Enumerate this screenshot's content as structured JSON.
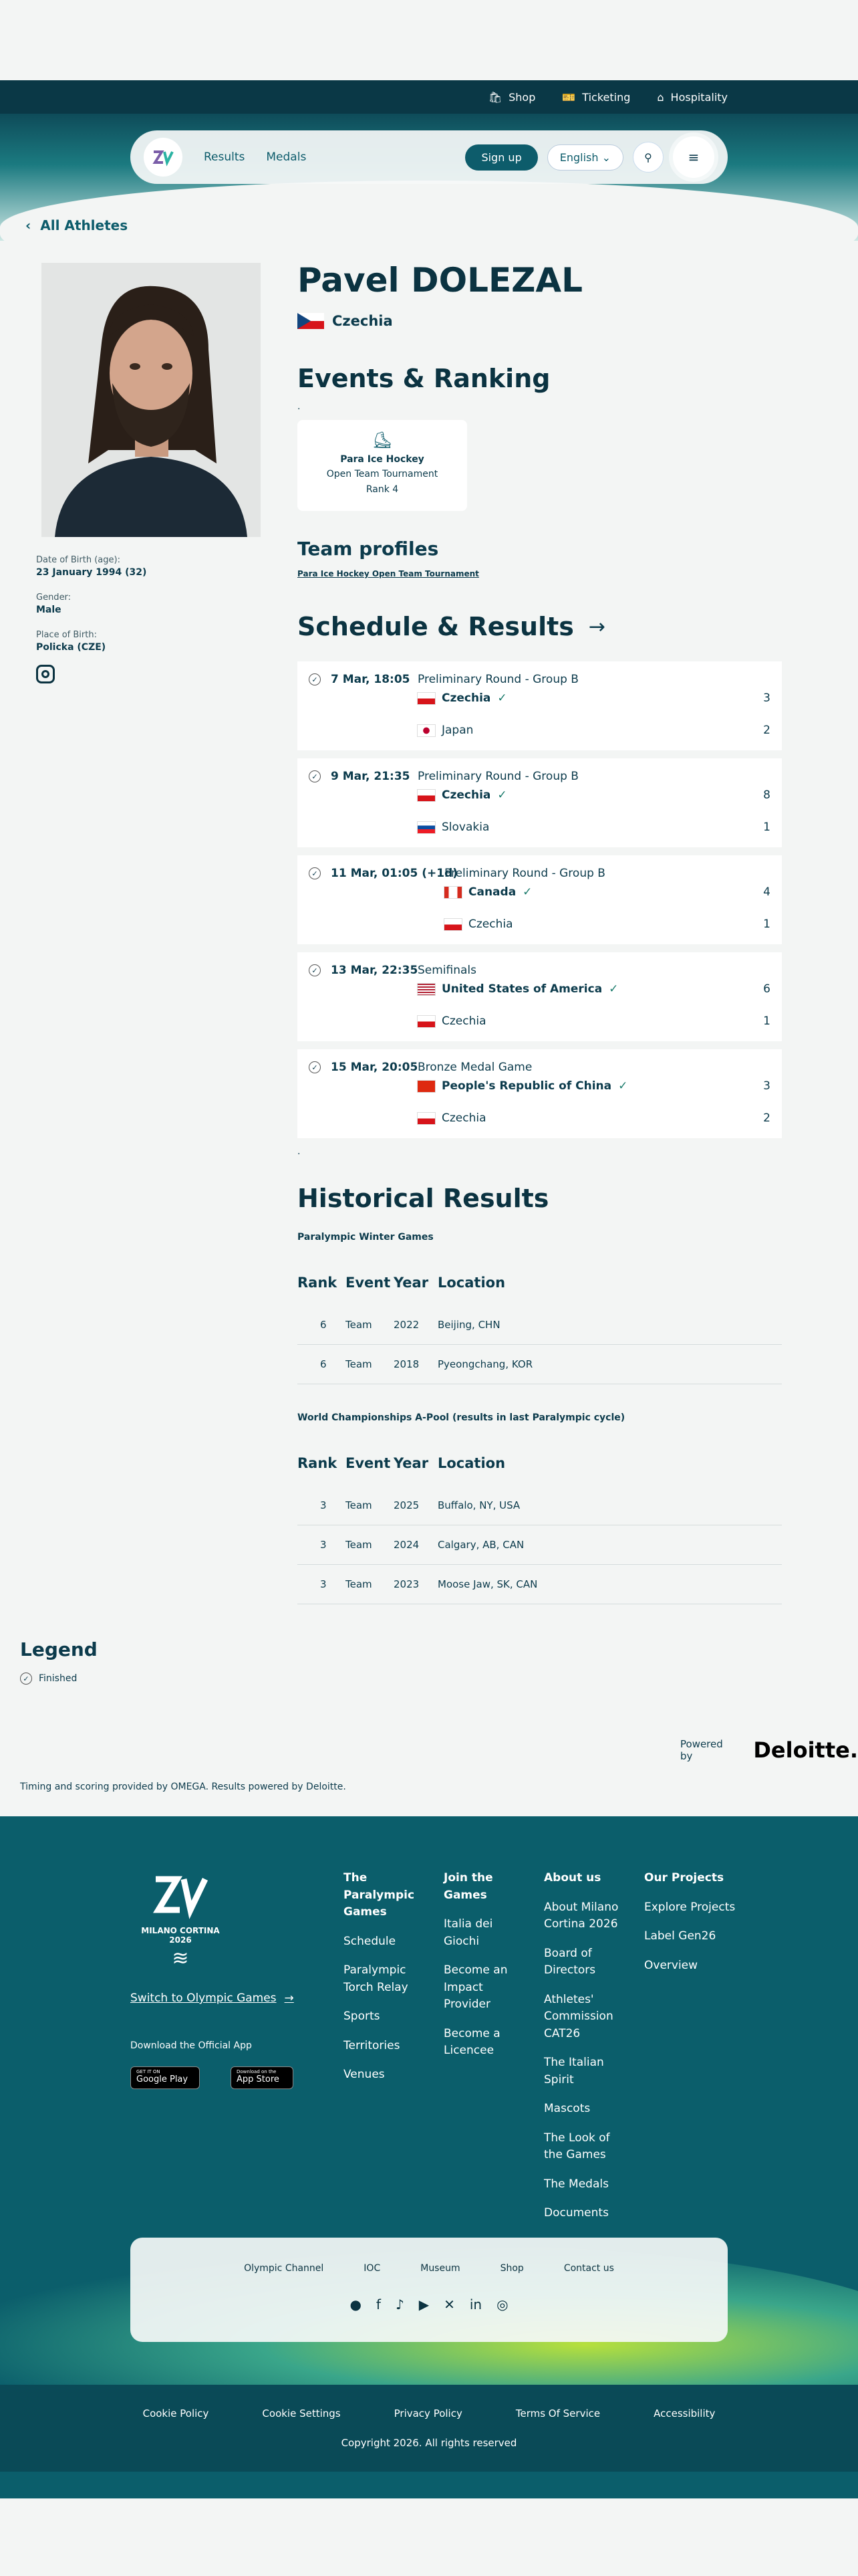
{
  "topbar": {
    "shop": "Shop",
    "ticketing": "Ticketing",
    "hospitality": "Hospitality"
  },
  "nav": {
    "results": "Results",
    "medals": "Medals",
    "signup": "Sign up",
    "language": "English"
  },
  "back_label": "All Athletes",
  "athlete": {
    "name": "Pavel DOLEZAL",
    "country": "Czechia"
  },
  "bio": {
    "dob_label": "Date of Birth (age):",
    "dob": "23 January 1994 (32)",
    "gender_label": "Gender:",
    "gender": "Male",
    "pob_label": "Place of Birth:",
    "pob": "Policka (CZE)"
  },
  "events": {
    "title": "Events & Ranking",
    "dot": ".",
    "sport": "Para Ice Hockey",
    "event": "Open Team Tournament",
    "rank": "Rank 4"
  },
  "team": {
    "title": "Team profiles",
    "link": "Para Ice Hockey Open Team Tournament"
  },
  "schedule": {
    "title": "Schedule & Results",
    "dot": ".",
    "matches": [
      {
        "time": "7 Mar, 18:05",
        "round": "Preliminary Round - Group B",
        "t1": "Czechia",
        "s1": "3",
        "t2": "Japan",
        "s2": "2"
      },
      {
        "time": "9 Mar, 21:35",
        "round": "Preliminary Round - Group B",
        "t1": "Czechia",
        "s1": "8",
        "t2": "Slovakia",
        "s2": "1"
      },
      {
        "time": "11 Mar, 01:05 (+1d)",
        "round": "Preliminary Round - Group B",
        "t1": "Canada",
        "s1": "4",
        "t2": "Czechia",
        "s2": "1"
      },
      {
        "time": "13 Mar, 22:35",
        "round": "Semifinals",
        "t1": "United States of America",
        "s1": "6",
        "t2": "Czechia",
        "s2": "1"
      },
      {
        "time": "15 Mar, 20:05",
        "round": "Bronze Medal Game",
        "t1": "People's Republic of China",
        "s1": "3",
        "t2": "Czechia",
        "s2": "2"
      }
    ]
  },
  "historical": {
    "title": "Historical Results",
    "games1": "Paralympic Winter Games",
    "games2": "World Championships A-Pool (results in last Paralympic cycle)",
    "headers": [
      "Rank",
      "Event",
      "Year",
      "Location"
    ],
    "rows1": [
      [
        "6",
        "Team",
        "2022",
        "Beijing, CHN"
      ],
      [
        "6",
        "Team",
        "2018",
        "Pyeongchang, KOR"
      ]
    ],
    "rows2": [
      [
        "3",
        "Team",
        "2025",
        "Buffalo, NY, USA"
      ],
      [
        "3",
        "Team",
        "2024",
        "Calgary, AB, CAN"
      ],
      [
        "3",
        "Team",
        "2023",
        "Moose Jaw, SK, CAN"
      ]
    ]
  },
  "legend": {
    "title": "Legend",
    "finished": "Finished"
  },
  "powered": {
    "label": "Powered by",
    "brand": "Deloitte."
  },
  "timing": "Timing and scoring provided by OMEGA. Results powered by Deloitte.",
  "footer": {
    "logo_text": "MILANO CORTINA 2026",
    "switch": "Switch to Olympic Games",
    "app_label": "Download the Official App",
    "gp_small": "GET IT ON",
    "gp": "Google Play",
    "as_small": "Download on the",
    "as": "App Store",
    "col1": {
      "h": "The Paralympic Games",
      "items": [
        "Schedule",
        "Paralympic Torch Relay",
        "Sports",
        "Territories",
        "Venues"
      ]
    },
    "col2": {
      "h": "Join the Games",
      "items": [
        "Italia dei Giochi",
        "Become an Impact Provider",
        "Become a Licencee"
      ]
    },
    "col3": {
      "h": "About us",
      "items": [
        "About Milano Cortina 2026",
        "Board of Directors",
        "Athletes' Commission CAT26",
        "The Italian Spirit",
        "Mascots",
        "The Look of the Games",
        "The Medals",
        "Documents"
      ]
    },
    "col4": {
      "h": "Our Projects",
      "items": [
        "Explore Projects",
        "Label Gen26",
        "Overview"
      ]
    },
    "panel_links": [
      "Olympic Channel",
      "IOC",
      "Museum",
      "Shop",
      "Contact us"
    ],
    "bottom_links": [
      "Cookie Policy",
      "Cookie Settings",
      "Privacy Policy",
      "Terms Of Service",
      "Accessibility"
    ],
    "copyright": "Copyright 2026. All rights reserved"
  },
  "colors": {
    "brand": "#0d5c6b",
    "dark": "#0b3341",
    "footer": "#0b5e6b"
  }
}
